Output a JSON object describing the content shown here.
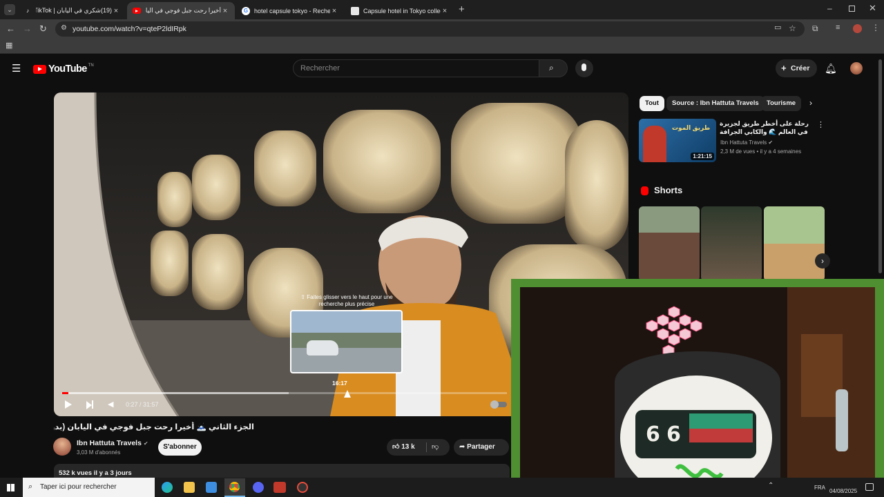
{
  "browser": {
    "tabs": [
      {
        "label": "(19)شكري في اليابان | TikTok",
        "icon": "tiktok-icon"
      },
      {
        "label": "أخيرا رحت جبل فوجي في اليابان (",
        "icon": "youtube-icon"
      },
      {
        "label": "hotel capsule tokyo - Recherche",
        "icon": "google-icon"
      },
      {
        "label": "Capsule hotel in Tokyo collectio",
        "icon": "web-icon"
      }
    ],
    "url": "youtube.com/watch?v=qteP2ldIRpk"
  },
  "youtube": {
    "logo": "YouTube",
    "logo_suffix": "TN",
    "search_placeholder": "Rechercher",
    "create_label": "Créer"
  },
  "player": {
    "hint_text": "Faites glisser vers le haut pour une recherche plus précise",
    "preview_time": "16:17",
    "time_display": "0:27 / 31:57",
    "progress_played": 0.014,
    "progress_hover": 0.51
  },
  "video": {
    "title": "الجزء الثاني 🗻 أخيرا رحت جبل فوجي في اليابان (بدون خطة) 🇯🇵",
    "channel": "Ibn Hattuta Travels",
    "subscribers": "3,03 M d'abonnés",
    "subscribe_label": "S'abonner",
    "likes": "13 k",
    "share_label": "Partager",
    "views_date": "532 k vues  il y a 3 jours"
  },
  "sidebar": {
    "chips": [
      "Tout",
      "Source : Ibn Hattuta Travels",
      "Tourisme"
    ],
    "recommended": {
      "title": "رحلة على أخطر طريق لجزيرة في العالم 🌊 والكابي الجرافة",
      "channel": "Ibn Hattuta Travels",
      "meta": "2,3 M de vues • il y a 4 semaines",
      "duration": "1:21:15",
      "thumb_text": "طريق الموت"
    },
    "shorts_heading": "Shorts"
  },
  "taskbar": {
    "search_placeholder": "Taper ici pour rechercher",
    "lang": "FRA",
    "date": "04/08/2025"
  },
  "colors": {
    "yt_red": "#ff0000",
    "overlay_green": "#3b7a2a",
    "bg": "#0f0f0f"
  }
}
